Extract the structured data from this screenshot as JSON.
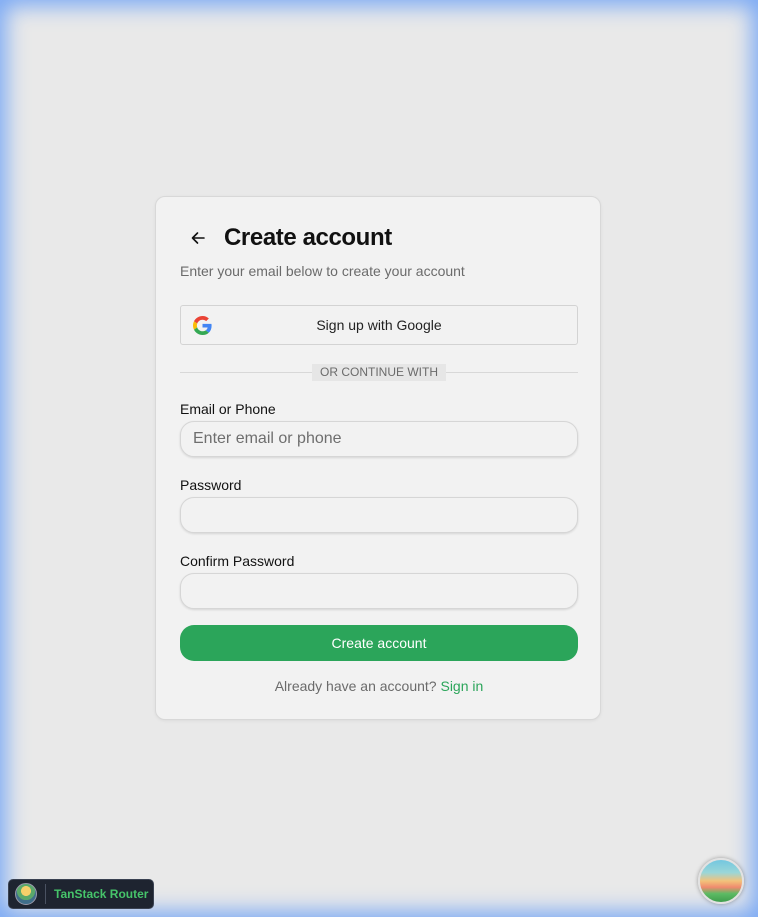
{
  "card": {
    "title": "Create account",
    "subtitle": "Enter your email below to create your account",
    "google_button": "Sign up with Google",
    "divider_text": "Or continue with",
    "email": {
      "label": "Email or Phone",
      "placeholder": "Enter email or phone",
      "value": ""
    },
    "password": {
      "label": "Password",
      "value": ""
    },
    "confirm_password": {
      "label": "Confirm Password",
      "value": ""
    },
    "submit_button": "Create account",
    "signin_prompt": "Already have an account?",
    "signin_link": "Sign in"
  },
  "footer": {
    "badge_text": "TanStack Router"
  },
  "icons": {
    "back": "arrow-left-icon",
    "google": "google-icon",
    "router_logo": "tanstack-logo-icon",
    "devtools": "devtools-logo-icon"
  },
  "colors": {
    "accent": "#2ba55a",
    "background": "#e9e9e9",
    "card": "#f2f2f2",
    "badge_bg": "#1e2430",
    "badge_text": "#46c46a"
  }
}
